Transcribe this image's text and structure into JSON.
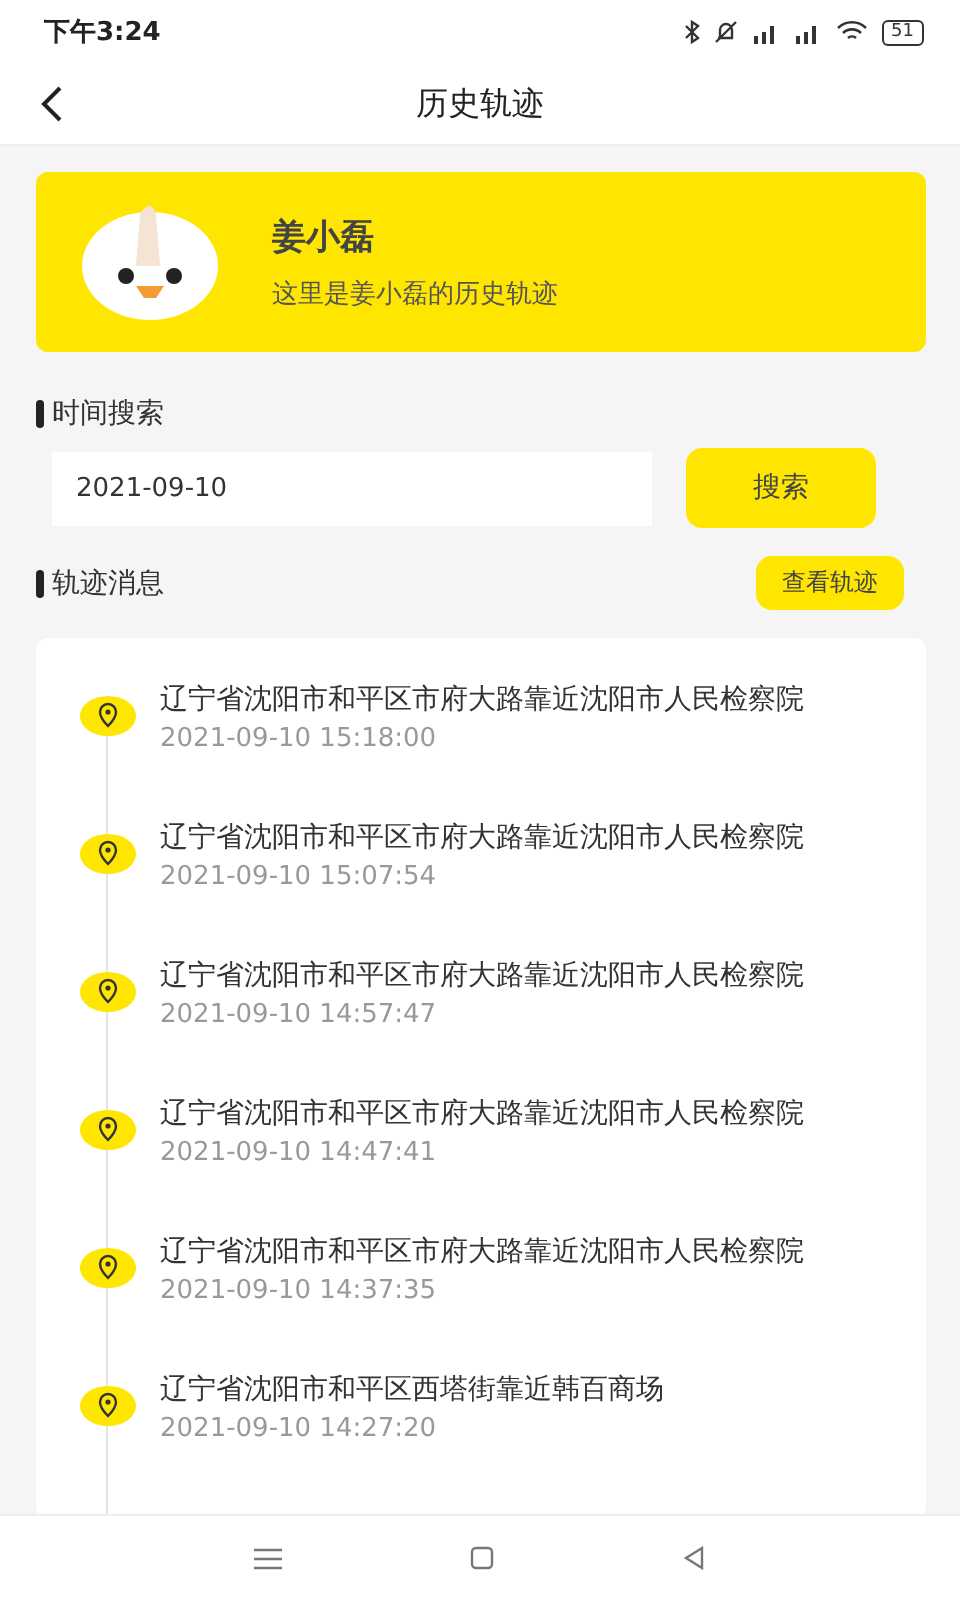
{
  "status_bar": {
    "time": "下午3:24",
    "battery": "51"
  },
  "header": {
    "title": "历史轨迹"
  },
  "profile": {
    "name": "姜小磊",
    "subtitle": "这里是姜小磊的历史轨迹"
  },
  "search_section": {
    "title": "时间搜索",
    "date_value": "2021-09-10",
    "button": "搜索"
  },
  "track_section": {
    "title": "轨迹消息",
    "button": "查看轨迹"
  },
  "track_items": [
    {
      "address": "辽宁省沈阳市和平区市府大路靠近沈阳市人民检察院",
      "time": "2021-09-10 15:18:00"
    },
    {
      "address": "辽宁省沈阳市和平区市府大路靠近沈阳市人民检察院",
      "time": "2021-09-10 15:07:54"
    },
    {
      "address": "辽宁省沈阳市和平区市府大路靠近沈阳市人民检察院",
      "time": "2021-09-10 14:57:47"
    },
    {
      "address": "辽宁省沈阳市和平区市府大路靠近沈阳市人民检察院",
      "time": "2021-09-10 14:47:41"
    },
    {
      "address": "辽宁省沈阳市和平区市府大路靠近沈阳市人民检察院",
      "time": "2021-09-10 14:37:35"
    },
    {
      "address": "辽宁省沈阳市和平区西塔街靠近韩百商场",
      "time": "2021-09-10 14:27:20"
    }
  ]
}
